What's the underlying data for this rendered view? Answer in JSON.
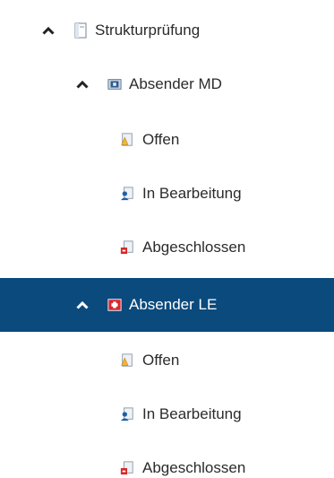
{
  "tree": {
    "root": {
      "label": "Strukturprüfung",
      "icon": "document-icon",
      "expanded": true
    },
    "groups": [
      {
        "label": "Absender MD",
        "icon": "md-sender-icon",
        "expanded": true,
        "selected": false,
        "children": [
          {
            "label": "Offen",
            "icon": "open-status-icon"
          },
          {
            "label": "In Bearbeitung",
            "icon": "in-progress-icon"
          },
          {
            "label": "Abgeschlossen",
            "icon": "completed-icon"
          }
        ]
      },
      {
        "label": "Absender LE",
        "icon": "le-sender-icon",
        "expanded": true,
        "selected": true,
        "children": [
          {
            "label": "Offen",
            "icon": "open-status-icon"
          },
          {
            "label": "In Bearbeitung",
            "icon": "in-progress-icon"
          },
          {
            "label": "Abgeschlossen",
            "icon": "completed-icon"
          }
        ]
      }
    ]
  },
  "colors": {
    "selected_background": "#0a4a7d",
    "selected_text": "#ffffff",
    "text": "#2b2b2b"
  }
}
